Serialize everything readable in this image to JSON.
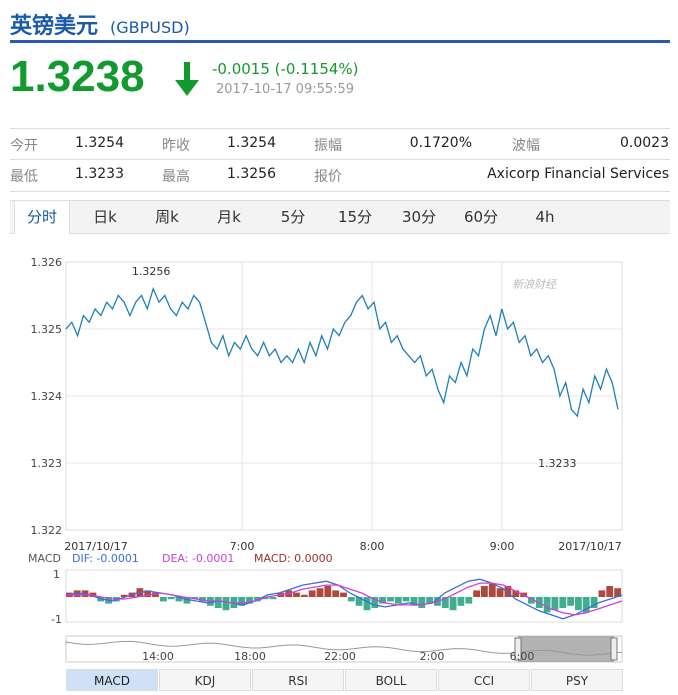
{
  "header": {
    "title": "英镑美元",
    "code": "(GBPUSD)"
  },
  "quote": {
    "price": "1.3238",
    "change": "-0.0015 (-0.1154%)",
    "timestamp": "2017-10-17 09:55:59",
    "color": "#129a2e"
  },
  "stats": {
    "row1": [
      {
        "label": "今开",
        "value": "1.3254"
      },
      {
        "label": "昨收",
        "value": "1.3254"
      },
      {
        "label": "振幅",
        "value": "0.1720%"
      },
      {
        "label": "波幅",
        "value": "0.0023"
      }
    ],
    "row2": [
      {
        "label": "最低",
        "value": "1.3233"
      },
      {
        "label": "最高",
        "value": "1.3256"
      },
      {
        "label": "报价",
        "value": "Axicorp Financial Services"
      }
    ]
  },
  "tabs": [
    "分时",
    "日k",
    "周k",
    "月k",
    "5分",
    "15分",
    "30分",
    "60分",
    "4h"
  ],
  "active_tab": "分时",
  "watermark": "新浪财经",
  "chart_data": [
    {
      "type": "line",
      "series": [
        {
          "values": [
            1.325,
            1.3251,
            1.3249,
            1.3252,
            1.3251,
            1.3253,
            1.3252,
            1.3254,
            1.3253,
            1.3255,
            1.3254,
            1.3252,
            1.3254,
            1.3255,
            1.3253,
            1.3256,
            1.3254,
            1.3255,
            1.3253,
            1.3252,
            1.3254,
            1.3253,
            1.3255,
            1.3254,
            1.3251,
            1.3248,
            1.3247,
            1.3249,
            1.3246,
            1.3248,
            1.3247,
            1.3249,
            1.3247,
            1.3246,
            1.3248,
            1.3246,
            1.3247,
            1.3245,
            1.3246,
            1.3245,
            1.3247,
            1.3245,
            1.3248,
            1.3246,
            1.3249,
            1.3247,
            1.325,
            1.3249,
            1.3251,
            1.3252,
            1.3254,
            1.3255,
            1.3253,
            1.3254,
            1.325,
            1.3251,
            1.3248,
            1.3249,
            1.3247,
            1.3246,
            1.3245,
            1.3246,
            1.3243,
            1.3244,
            1.3241,
            1.3239,
            1.3243,
            1.3242,
            1.3245,
            1.3243,
            1.3247,
            1.3246,
            1.325,
            1.3252,
            1.3249,
            1.3253,
            1.325,
            1.3251,
            1.3248,
            1.3249,
            1.3246,
            1.3247,
            1.3245,
            1.3246,
            1.3244,
            1.324,
            1.3242,
            1.3238,
            1.3237,
            1.3241,
            1.3239,
            1.3243,
            1.3241,
            1.3244,
            1.3242,
            1.3238
          ]
        }
      ],
      "x_ticks": [
        "2017/10/17",
        "7:00",
        "8:00",
        "9:00",
        "2017/10/17"
      ],
      "y_ticks": [
        "1.326",
        "1.325",
        "1.324",
        "1.323",
        "1.322"
      ],
      "ylim": [
        1.322,
        1.326
      ],
      "annotations": [
        {
          "text": "1.3256",
          "value": 1.3256
        },
        {
          "text": "1.3233",
          "value": 1.3233
        }
      ],
      "line_color": "#1f7fb8"
    },
    {
      "type": "bar",
      "label": "MACD",
      "legend": [
        {
          "name": "DIF: -0.0001",
          "color": "#3a6fd8"
        },
        {
          "name": "DEA: -0.0001",
          "color": "#d040d8"
        },
        {
          "name": "MACD: 0.0000",
          "color": "#a0302a"
        }
      ],
      "y_ticks": [
        "1",
        "-1"
      ],
      "ylim": [
        -1,
        1
      ],
      "values": [
        0.2,
        0.3,
        0.3,
        0.2,
        -0.2,
        -0.3,
        -0.2,
        0.1,
        0.2,
        0.4,
        0.3,
        0.2,
        -0.2,
        -0.1,
        -0.2,
        -0.3,
        -0.1,
        -0.2,
        -0.4,
        -0.5,
        -0.6,
        -0.5,
        -0.4,
        -0.3,
        -0.2,
        -0.1,
        -0.1,
        0.2,
        0.3,
        0.2,
        0.1,
        0.3,
        0.4,
        0.5,
        0.3,
        0.2,
        -0.2,
        -0.4,
        -0.6,
        -0.5,
        -0.3,
        -0.2,
        -0.3,
        -0.2,
        -0.4,
        -0.5,
        -0.3,
        -0.4,
        -0.5,
        -0.6,
        -0.4,
        -0.3,
        0.3,
        0.5,
        0.6,
        0.4,
        0.5,
        0.3,
        0.2,
        -0.3,
        -0.5,
        -0.7,
        -0.6,
        -0.5,
        -0.4,
        -0.6,
        -0.7,
        -0.5,
        0.3,
        0.5,
        0.4
      ],
      "dif": [
        0.1,
        0.2,
        0.1,
        -0.1,
        -0.2,
        0.0,
        0.2,
        0.3,
        0.2,
        0.1,
        -0.1,
        -0.2,
        -0.3,
        -0.2,
        -0.3,
        -0.4,
        -0.2,
        0.1,
        0.2,
        0.4,
        0.6,
        0.7,
        0.8,
        0.6,
        0.2,
        -0.1,
        -0.4,
        -0.5,
        -0.4,
        -0.3,
        -0.4,
        -0.3,
        0.2,
        0.5,
        0.8,
        0.9,
        0.7,
        0.4,
        -0.1,
        -0.4,
        -0.7,
        -0.9,
        -1.1,
        -0.9,
        -0.6,
        -0.3,
        -0.1,
        0.1
      ],
      "dea": [
        0.1,
        0.1,
        0.1,
        0.0,
        -0.1,
        -0.1,
        0.0,
        0.1,
        0.2,
        0.1,
        0.0,
        -0.1,
        -0.2,
        -0.2,
        -0.3,
        -0.3,
        -0.2,
        0.0,
        0.1,
        0.2,
        0.4,
        0.5,
        0.6,
        0.6,
        0.4,
        0.2,
        -0.1,
        -0.3,
        -0.4,
        -0.4,
        -0.4,
        -0.3,
        -0.1,
        0.2,
        0.5,
        0.7,
        0.7,
        0.6,
        0.3,
        0.0,
        -0.3,
        -0.6,
        -0.8,
        -0.9,
        -0.8,
        -0.6,
        -0.4,
        -0.2
      ]
    }
  ],
  "navigator": {
    "labels": [
      "14:00",
      "18:00",
      "22:00",
      "2:00",
      "6:00"
    ]
  },
  "indicators": [
    "MACD",
    "KDJ",
    "RSI",
    "BOLL",
    "CCI",
    "PSY"
  ],
  "active_indicator": "MACD"
}
